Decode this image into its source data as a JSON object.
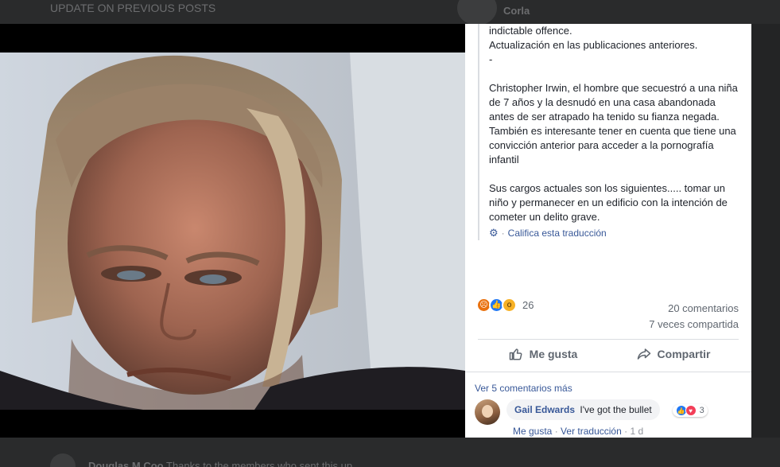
{
  "background": {
    "top_text": "UPDATE ON PREVIOUS POSTS",
    "top_right_name": "Corla",
    "bottom_name": "Douglas M Coo",
    "bottom_text": "Thanks to the members who sent this up"
  },
  "post": {
    "clipped_line": "indictable offence.",
    "translation_lines": [
      "Actualización en las publicaciones anteriores.",
      "-"
    ],
    "paragraph1": "Christopher Irwin, el hombre que secuestró a una niña de 7 años y la desnudó en una casa abandonada antes de ser atrapado ha tenido su fianza negada. También es interesante tener en cuenta que tiene una convicción anterior para acceder a la pornografía infantil",
    "paragraph2": "Sus cargos actuales son los siguientes..... tomar un niño y permanecer en un edificio con la intención de cometer un delito grave.",
    "rate_translation": "Califica esta traducción",
    "rate_separator": "·"
  },
  "stats": {
    "reactions_count": "26",
    "comments": "20 comentarios",
    "shares": "7 veces compartida"
  },
  "actions": {
    "like": "Me gusta",
    "share": "Compartir"
  },
  "comments": {
    "view_more": "Ver 5 comentarios más",
    "items": [
      {
        "author": "Gail Edwards",
        "text": "I've got the bullet",
        "reaction_count": "3",
        "like": "Me gusta",
        "translate": "Ver traducción",
        "time": "1 d",
        "separator": "·"
      }
    ]
  },
  "colors": {
    "link": "#385898",
    "muted": "#606770",
    "angry": "#e9710f",
    "like": "#2078f4",
    "love": "#f33e58"
  }
}
